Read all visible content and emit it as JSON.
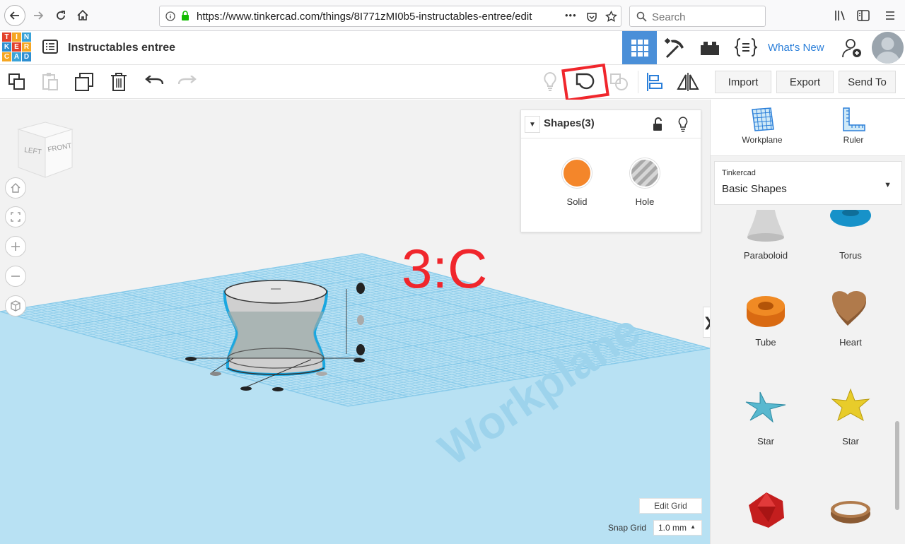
{
  "browser": {
    "url": "https://www.tinkercad.com/things/8I771zMI0b5-instructables-entree/edit",
    "search_placeholder": "Search",
    "url_more": "•••"
  },
  "header": {
    "logo_letters": [
      "T",
      "I",
      "N",
      "K",
      "E",
      "R",
      "C",
      "A",
      "D"
    ],
    "logo_colors": [
      "#e2412b",
      "#f5a623",
      "#3aa3d9",
      "#2e8fd1",
      "#e2412b",
      "#f5a623",
      "#f5a623",
      "#3aa3d9",
      "#2e8fd1"
    ],
    "design_title": "Instructables entree",
    "whats_new": "What's New"
  },
  "toolbar": {
    "import_label": "Import",
    "export_label": "Export",
    "send_to_label": "Send To"
  },
  "viewport": {
    "cube_left": "LEFT",
    "cube_front": "FRONT",
    "overlay_label": "3:C",
    "workplane_watermark": "Workplane",
    "edit_grid": "Edit Grid",
    "snap_grid_label": "Snap Grid",
    "snap_grid_value": "1.0 mm",
    "snap_caret": "▲",
    "collapse_caret": "❯"
  },
  "shapes_panel": {
    "title": "Shapes(3)",
    "caret": "▼",
    "solid_label": "Solid",
    "solid_color": "#f4862a",
    "hole_label": "Hole"
  },
  "right_panel": {
    "workplane_label": "Workplane",
    "ruler_label": "Ruler",
    "library_small": "Tinkercad",
    "library_name": "Basic Shapes",
    "library_caret": "▼",
    "shapes": [
      {
        "label": "Paraboloid"
      },
      {
        "label": "Torus"
      },
      {
        "label": "Tube"
      },
      {
        "label": "Heart"
      },
      {
        "label": "Star"
      },
      {
        "label": "Star"
      }
    ]
  },
  "colors": {
    "accent_blue": "#4a8fd8",
    "highlight_red": "#f0262c",
    "grid_blue": "#8fd0ec"
  }
}
